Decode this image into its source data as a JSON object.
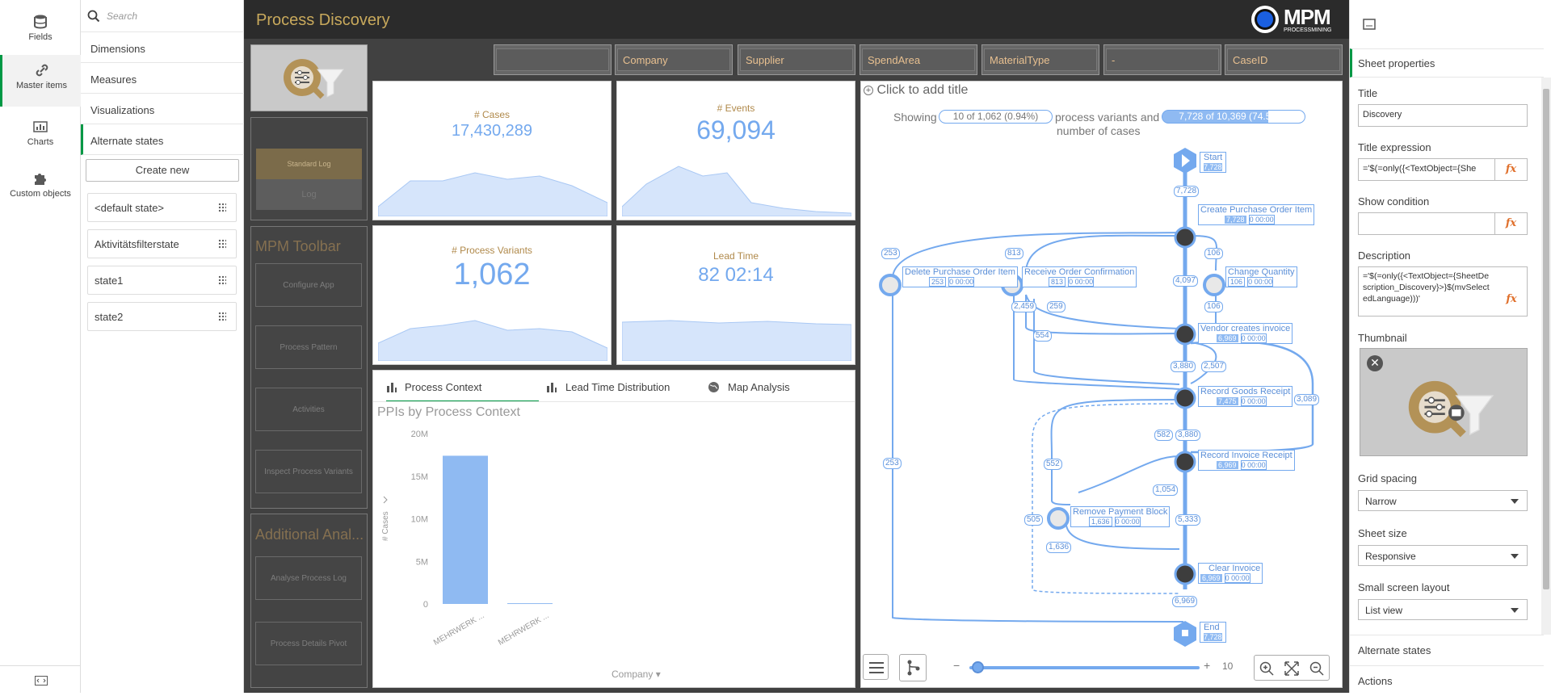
{
  "leftnav": {
    "items": [
      {
        "label": "Fields",
        "icon": "database-icon"
      },
      {
        "label": "Master items",
        "icon": "link-icon"
      },
      {
        "label": "Charts",
        "icon": "bar-chart-icon"
      },
      {
        "label": "Custom objects",
        "icon": "puzzle-icon"
      }
    ],
    "bottom_icon": "code-icon"
  },
  "library": {
    "search_placeholder": "Search",
    "categories": [
      "Dimensions",
      "Measures",
      "Visualizations",
      "Alternate states"
    ],
    "create_new": "Create new",
    "states": [
      "<default state>",
      "Aktivitätsfilterstate",
      "state1",
      "state2"
    ]
  },
  "header": {
    "title": "Process Discovery",
    "logo_text": "MPM",
    "logo_sub": "PROCESSMINING"
  },
  "filters": [
    "",
    "Company",
    "Supplier",
    "SpendArea",
    "MaterialType",
    "-",
    "CaseID"
  ],
  "toolbar": {
    "standard_log": "Standard Log",
    "log": "Log",
    "mpm_title": "MPM Toolbar",
    "configure_app": "Configure App",
    "process_pattern": "Process Pattern",
    "activities": "Activities",
    "inspect_variants": "Inspect Process Variants",
    "additional_title": "Additional Anal...",
    "analyse_log": "Analyse Process Log",
    "process_details": "Process Details Pivot"
  },
  "kpis": {
    "cases": {
      "label": "# Cases",
      "value": "17,430,289"
    },
    "events": {
      "label": "# Events",
      "value": "69,094"
    },
    "variants": {
      "label": "# Process Variants",
      "value": "1,062"
    },
    "leadtime": {
      "label": "Lead Time",
      "value": "82 02:14"
    }
  },
  "tabs": [
    "Process Context",
    "Lead Time Distribution",
    "Map Analysis"
  ],
  "chart_data": {
    "type": "bar",
    "title": "PPIs by Process Context",
    "categories": [
      "MEHRWERK ...",
      "MEHRWERK ..."
    ],
    "values": [
      17400000,
      90000
    ],
    "xlabel": "Company",
    "ylabel": "# Cases",
    "ylim": [
      0,
      20000000
    ],
    "ticks": [
      "20M",
      "15M",
      "10M",
      "5M",
      "0"
    ]
  },
  "process_map": {
    "add_title": "Click to add title",
    "showing": "Showing",
    "variants_badge": "10 of 1,062 (0.94%)",
    "mid_text_1": "process variants and",
    "mid_text_2": "number of cases",
    "cases_badge": "7,728 of 10,369 (74.53%)",
    "nodes": [
      {
        "name": "Start",
        "stat": "7,728"
      },
      {
        "name": "Create Purchase Order Item",
        "stat": "7,728",
        "time": "0 00:00"
      },
      {
        "name": "Delete Purchase Order Item",
        "stat": "253",
        "time": "0 00:00"
      },
      {
        "name": "Receive Order Confirmation",
        "stat": "813",
        "time": "0 00:00"
      },
      {
        "name": "Change Quantity",
        "stat": "106",
        "time": "0 00:00"
      },
      {
        "name": "Vendor creates invoice",
        "stat": "6,969",
        "time": "0 00:00"
      },
      {
        "name": "Record Goods Receipt",
        "stat": "7,475",
        "time": "0 00:00"
      },
      {
        "name": "Record Invoice Receipt",
        "stat": "6,969",
        "time": "0 00:00"
      },
      {
        "name": "Remove Payment Block",
        "stat": "1,636",
        "time": "0 00:00"
      },
      {
        "name": "Clear Invoice",
        "stat": "6,969",
        "time": "0 00:00"
      },
      {
        "name": "End",
        "stat": "7,728"
      }
    ],
    "edges": [
      "7,728",
      "253",
      "813",
      "106",
      "4,097",
      "2,459",
      "259",
      "106",
      "554",
      "3,880",
      "2,507",
      "3,089",
      "582",
      "3,880",
      "552",
      "1,054",
      "505",
      "5,333",
      "1,636",
      "6,969",
      "253"
    ],
    "slider_minus": "−",
    "slider_plus": "+",
    "slider_value": "10"
  },
  "rightpanel": {
    "sheet_properties": "Sheet properties",
    "title_label": "Title",
    "title_value": "Discovery",
    "title_expr_label": "Title expression",
    "title_expr_value": "='$(=only({<TextObject={She",
    "show_condition_label": "Show condition",
    "show_condition_value": "",
    "description_label": "Description",
    "description_value": "='$(=only({<TextObject={SheetDescription_Discovery}>}$(mvSelectedLanguage)))'",
    "thumbnail_label": "Thumbnail",
    "grid_label": "Grid spacing",
    "grid_value": "Narrow",
    "size_label": "Sheet size",
    "size_value": "Responsive",
    "small_label": "Small screen layout",
    "small_value": "List view",
    "alt_states": "Alternate states",
    "actions": "Actions",
    "fx": "fx"
  }
}
